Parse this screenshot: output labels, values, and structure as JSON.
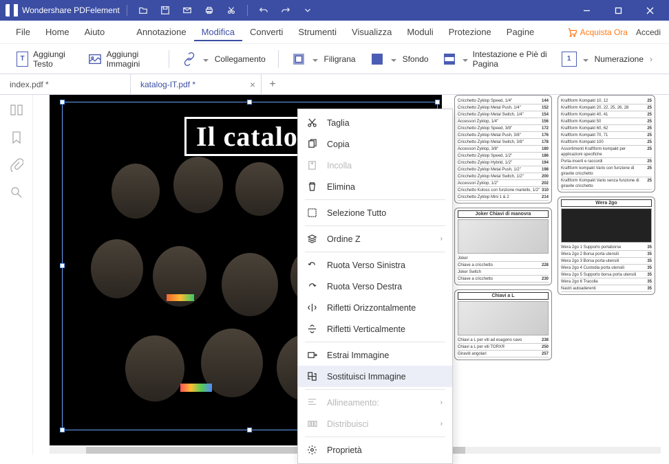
{
  "app_title": "Wondershare PDFelement",
  "menubar": {
    "items": [
      "File",
      "Home",
      "Aiuto",
      "Annotazione",
      "Modifica",
      "Converti",
      "Strumenti",
      "Visualizza",
      "Moduli",
      "Protezione",
      "Pagine"
    ],
    "active_index": 4,
    "buy": "Acquista Ora",
    "login": "Accedi"
  },
  "toolbar": {
    "add_text": "Aggiungi Testo",
    "add_images": "Aggiungi Immagini",
    "link": "Collegamento",
    "watermark": "Filigrana",
    "background": "Sfondo",
    "header_footer": "Intestazione e Piè di Pagina",
    "numbering": "Numerazione"
  },
  "tabs": {
    "items": [
      {
        "label": "index.pdf *",
        "active": false
      },
      {
        "label": "katalog-IT.pdf *",
        "active": true
      }
    ]
  },
  "cover": {
    "title": "Il catalo"
  },
  "context_menu": {
    "cut": "Taglia",
    "copy": "Copia",
    "paste": "Incolla",
    "delete": "Elimina",
    "select_all": "Selezione Tutto",
    "order_z": "Ordine Z",
    "rotate_left": "Ruota Verso Sinistra",
    "rotate_right": "Ruota Verso Destra",
    "flip_h": "Rifletti Orizzontalmente",
    "flip_v": "Rifletti Verticalmente",
    "extract_image": "Estrai Immagine",
    "replace_image": "Sostituisci Immagine",
    "alignment": "Allineamento:",
    "distribute": "Distribuisci",
    "properties": "Proprietà"
  },
  "catalog_right": {
    "col1": {
      "rows1": [
        [
          "Cricchetto Zyklop Speed, 1/4\"",
          "144"
        ],
        [
          "Cricchetto Zyklop Metal Push, 1/4\"",
          "152"
        ],
        [
          "Cricchetto Zyklop Metal Switch, 1/4\"",
          "154"
        ],
        [
          "Accessori Zyklop, 1/4\"",
          "156"
        ],
        [
          "Cricchetto Zyklop Speed, 3/8\"",
          "172"
        ],
        [
          "Cricchetto Zyklop Metal Push, 3/8\"",
          "176"
        ],
        [
          "Cricchetto Zyklop Metal Switch, 3/8\"",
          "178"
        ],
        [
          "Accessori Zyklop, 3/8\"",
          "180"
        ],
        [
          "Cricchetto Zyklop Speed, 1/2\"",
          "186"
        ],
        [
          "Cricchetto Zyklop Hybrid, 1/2\"",
          "194"
        ],
        [
          "Cricchetto Zyklop Metal Push, 1/2\"",
          "198"
        ],
        [
          "Cricchetto Zyklop Metal Switch, 1/2\"",
          "200"
        ],
        [
          "Accessori Zyklop, 1/2\"",
          "202"
        ],
        [
          "Cricchetto Koloss con funzione martello, 1/2\"",
          "310"
        ],
        [
          "Cricchetto Zyklop Mini 1 & 2",
          "214"
        ]
      ],
      "section2": "Joker\nChiavi di manovra",
      "rows2": [
        [
          "Joker",
          ""
        ],
        [
          "Chiave a cricchetto",
          "228"
        ],
        [
          "Joker Switch",
          ""
        ],
        [
          "Chiave a cricchetto",
          "230"
        ]
      ],
      "section3": "Chiavi a L",
      "rows3": [
        [
          "Chiavi a L per viti ad esagono cavo",
          "238"
        ],
        [
          "Chiavi a L per viti TORX®",
          "250"
        ],
        [
          "Giraviti angolari",
          "257"
        ]
      ]
    },
    "col2": {
      "rows1": [
        [
          "Kraftform Kompakt 10, 12",
          "25"
        ],
        [
          "Kraftform Kompakt 20, 22, 25, 26, 28",
          "25"
        ],
        [
          "Kraftform Kompakt 40, 41",
          "25"
        ],
        [
          "Kraftform Kompakt 50",
          "25"
        ],
        [
          "Kraftform Kompakt 60, 62",
          "25"
        ],
        [
          "Kraftform Kompakt 70, 71",
          "25"
        ],
        [
          "Kraftform Kompakt 100",
          "25"
        ],
        [
          "Assortimenti Kraftform kompakt per applicazioni specifiche",
          "25"
        ],
        [
          "Porta-inserti e raccordi",
          "25"
        ],
        [
          "Kraftform kompakt Vario con funzione di giravite cricchetto",
          "25"
        ],
        [
          "Kraftform Kompakt Vario senza funzione di giravite cricchetto",
          "25"
        ]
      ],
      "section2": "Wera 2go",
      "rows2": [
        [
          "Wera 2go 1 Supporto portaborse",
          "35"
        ],
        [
          "Wera 2go 2 Borsa porta utensili",
          "35"
        ],
        [
          "Wera 2go 3 Borsa porta-utensili",
          "35"
        ],
        [
          "Wera 2go 4 Custodia porta utensili",
          "35"
        ],
        [
          "Wera 2go 5 Supporto borsa porta utensili",
          "35"
        ],
        [
          "Wera 2go 6 Tracolla",
          "35"
        ],
        [
          "Nastri autoaderenti",
          "35"
        ]
      ]
    }
  }
}
